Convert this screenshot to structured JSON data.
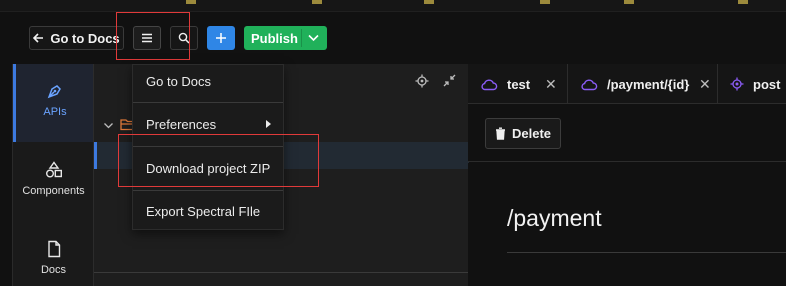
{
  "toolbar": {
    "go_to_docs": "Go to Docs",
    "menu_icon": "hamburger-menu-icon",
    "search_icon": "search-icon",
    "add_icon": "plus-icon",
    "publish": "Publish"
  },
  "rail": {
    "items": [
      {
        "label": "APIs",
        "icon": "pen-nib-icon",
        "active": true
      },
      {
        "label": "Components",
        "icon": "shapes-icon",
        "active": false
      },
      {
        "label": "Docs",
        "icon": "document-icon",
        "active": false
      }
    ]
  },
  "menu": {
    "items": [
      {
        "label": "Go to Docs"
      },
      {
        "label": "Preferences",
        "has_submenu": true
      },
      {
        "label": "Download project ZIP"
      },
      {
        "label": "Export Spectral FIle"
      }
    ]
  },
  "tabs": [
    {
      "label": "test",
      "icon": "cloud-icon"
    },
    {
      "label": "/payment/{id}",
      "icon": "cloud-icon"
    },
    {
      "label": "post",
      "icon": "target-icon"
    }
  ],
  "actions": {
    "delete": "Delete"
  },
  "content": {
    "title": "/payment"
  },
  "colors": {
    "accent_blue": "#2f86e6",
    "publish_green": "#20b15a",
    "highlight_red": "#e03a3a",
    "tab_icon_purple": "#8b5cf6"
  }
}
